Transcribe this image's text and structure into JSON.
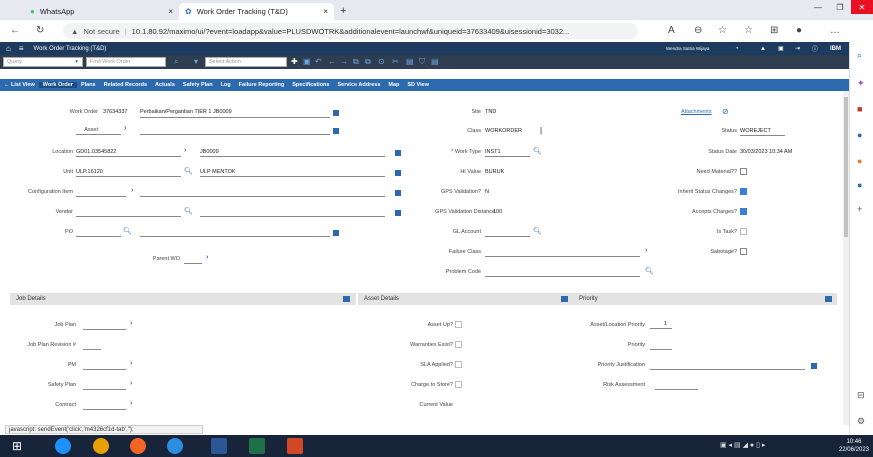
{
  "browser": {
    "tabs": [
      {
        "label": "WhatsApp",
        "close": "×"
      },
      {
        "label": "Work Order Tracking (T&D)",
        "close": "×"
      }
    ],
    "new_tab": "+",
    "not_secure": "Not secure",
    "url": "10.1.80.92/maximo/ui/?event=loadapp&value=PLUSDWOTRK&additionalevent=launchwf&uniqueid=37633409&uisessionid=3032..."
  },
  "maximo": {
    "app_title": "Work Order Tracking (T&D)",
    "user": "Wendra Satria Wijaya",
    "brand": "IBM",
    "query_placeholder": "Query",
    "find_placeholder": "Find Work Order",
    "action_placeholder": "Select Action"
  },
  "tabs": [
    {
      "label": "List View",
      "selected": false
    },
    {
      "label": "Work Order",
      "selected": true
    },
    {
      "label": "Plans",
      "selected": false
    },
    {
      "label": "Related Records",
      "selected": false
    },
    {
      "label": "Actuals",
      "selected": false
    },
    {
      "label": "Safety Plan",
      "selected": false
    },
    {
      "label": "Log",
      "selected": false
    },
    {
      "label": "Failure Reporting",
      "selected": false
    },
    {
      "label": "Specifications",
      "selected": false
    },
    {
      "label": "Service Address",
      "selected": false
    },
    {
      "label": "Map",
      "selected": false
    },
    {
      "label": "SD View",
      "selected": false
    }
  ],
  "form": {
    "work_order": {
      "label": "Work Order",
      "value": "37634337",
      "desc": "Perbaikan/Pergantian TIER 1 JB0009"
    },
    "asset": {
      "label": "Asset"
    },
    "location": {
      "label": "Location",
      "value": "GD01.03545822",
      "desc": "JB0009"
    },
    "unit": {
      "label": "Unit",
      "value": "ULP.16120",
      "desc": "ULP MENTOK"
    },
    "config_item": {
      "label": "Configuration Item"
    },
    "vendor": {
      "label": "Vendor"
    },
    "po": {
      "label": "PO"
    },
    "parent_wo": {
      "label": "Parent WO"
    },
    "site": {
      "label": "Site",
      "value": "TND"
    },
    "class": {
      "label": "Class",
      "value": "WORKORDER"
    },
    "work_type": {
      "label": "Work Type",
      "value": "INST1"
    },
    "hi_value": {
      "label": "HI Value",
      "value": "BURUK"
    },
    "gps_validation": {
      "label": "GPS Validation?",
      "value": "N"
    },
    "gps_distance": {
      "label": "GPS Validation Distance",
      "value": "100"
    },
    "gl_account": {
      "label": "GL Account"
    },
    "failure_class": {
      "label": "Failure Class"
    },
    "problem_code": {
      "label": "Problem Code"
    },
    "attachments": "Attachments",
    "status": {
      "label": "Status",
      "value": "WOREJECT"
    },
    "status_date": {
      "label": "Status Date",
      "value": "30/03/2023 10:34 AM"
    },
    "need_material": {
      "label": "Need Material??",
      "checked": false
    },
    "inherit_status": {
      "label": "Inherit Status Changes?",
      "checked": true
    },
    "accepts_charges": {
      "label": "Accepts Charges?",
      "checked": true
    },
    "is_task": {
      "label": "Is Task?",
      "checked": false
    },
    "sabotage": {
      "label": "Sabotage?",
      "checked": false
    }
  },
  "sections": {
    "job_details": {
      "title": "Job Details",
      "job_plan": "Job Plan",
      "job_plan_rev": "Job Plan Revision #",
      "pm": "PM",
      "safety_plan": "Safety Plan",
      "contract": "Contract"
    },
    "asset_details": {
      "title": "Asset Details",
      "asset_up": "Asset Up?",
      "warranties": "Warranties Exist?",
      "sla": "SLA Applied?",
      "charge_store": "Charge to Store?",
      "current_value": "Current Value"
    },
    "priority": {
      "title": "Priority",
      "loc_priority": "Asset/Location Priority",
      "loc_priority_value": "1",
      "priority": "Priority",
      "justification": "Priority Justification",
      "risk": "Risk Assessment"
    }
  },
  "statusbar": "javascript: sendEvent('click','m4326cf1d-tab','');",
  "clock": {
    "time": "10:46",
    "date": "22/06/2023"
  },
  "colors": {
    "header": "#1d3a5f",
    "tabs": "#2b6aae",
    "taskbar": "#18243a",
    "close": "#e81123"
  }
}
